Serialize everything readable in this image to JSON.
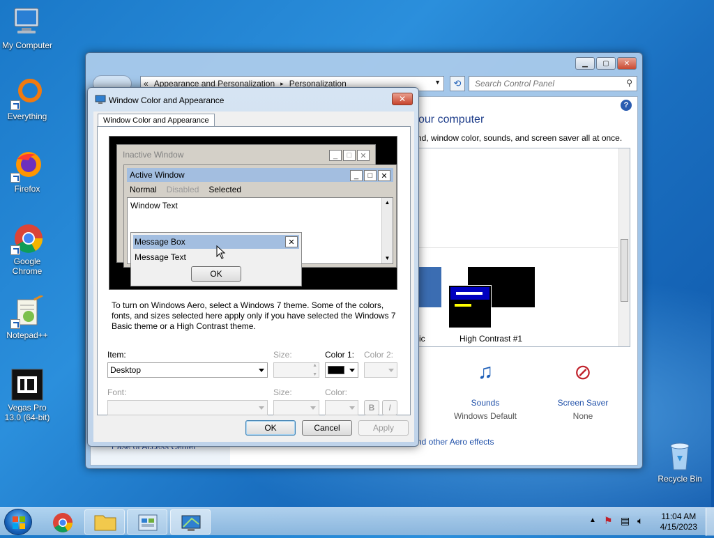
{
  "desktop": {
    "icons": [
      {
        "label": "My Computer"
      },
      {
        "label": "Everything"
      },
      {
        "label": "Firefox"
      },
      {
        "label": "Google Chrome"
      },
      {
        "label": "Notepad++"
      },
      {
        "label": "Vegas Pro 13.0 (64-bit)"
      },
      {
        "label": "Recycle Bin"
      }
    ]
  },
  "control_panel": {
    "breadcrumb": {
      "prefix": "«",
      "item1": "Appearance and Personalization",
      "sep": "▸",
      "item2": "Personalization"
    },
    "search_placeholder": "Search Control Panel",
    "help": "?",
    "title_fragment": "our computer",
    "desc_fragment": "nd, window color, sounds, and screen saver all at once.",
    "theme_label_fragment": "ic",
    "theme_high_contrast": "High Contrast #1",
    "sounds_label": "Sounds",
    "sounds_value": "Windows Default",
    "saver_label": "Screen Saver",
    "saver_value": "None",
    "aero_link": "nd other Aero effects",
    "side_link": "Ease of Access Center"
  },
  "dialog": {
    "title": "Window Color and Appearance",
    "close": "✕",
    "tab": "Window Color and Appearance",
    "preview": {
      "inactive": "Inactive Window",
      "active": "Active Window",
      "menu_normal": "Normal",
      "menu_disabled": "Disabled",
      "menu_selected": "Selected",
      "window_text": "Window Text",
      "msg_title": "Message Box",
      "msg_text": "Message Text",
      "msg_ok": "OK",
      "min": "_",
      "max": "□",
      "x": "✕"
    },
    "info": "To turn on Windows Aero, select a Windows 7 theme.  Some of the colors, fonts, and sizes selected here apply only if you have selected the Windows 7 Basic theme or a High Contrast theme.",
    "item_label": "Item:",
    "item_value": "Desktop",
    "size_label": "Size:",
    "color1_label": "Color 1:",
    "color2_label": "Color 2:",
    "font_label": "Font:",
    "font_size_label": "Size:",
    "font_color_label": "Color:",
    "bold": "B",
    "italic": "I",
    "ok": "OK",
    "cancel": "Cancel",
    "apply": "Apply"
  },
  "taskbar": {
    "time": "11:04 AM",
    "date": "4/15/2023"
  },
  "colors": {
    "color1_swatch": "#000000",
    "active_caption": "#a3bee0",
    "inactive_caption": "#d4d0c8"
  }
}
